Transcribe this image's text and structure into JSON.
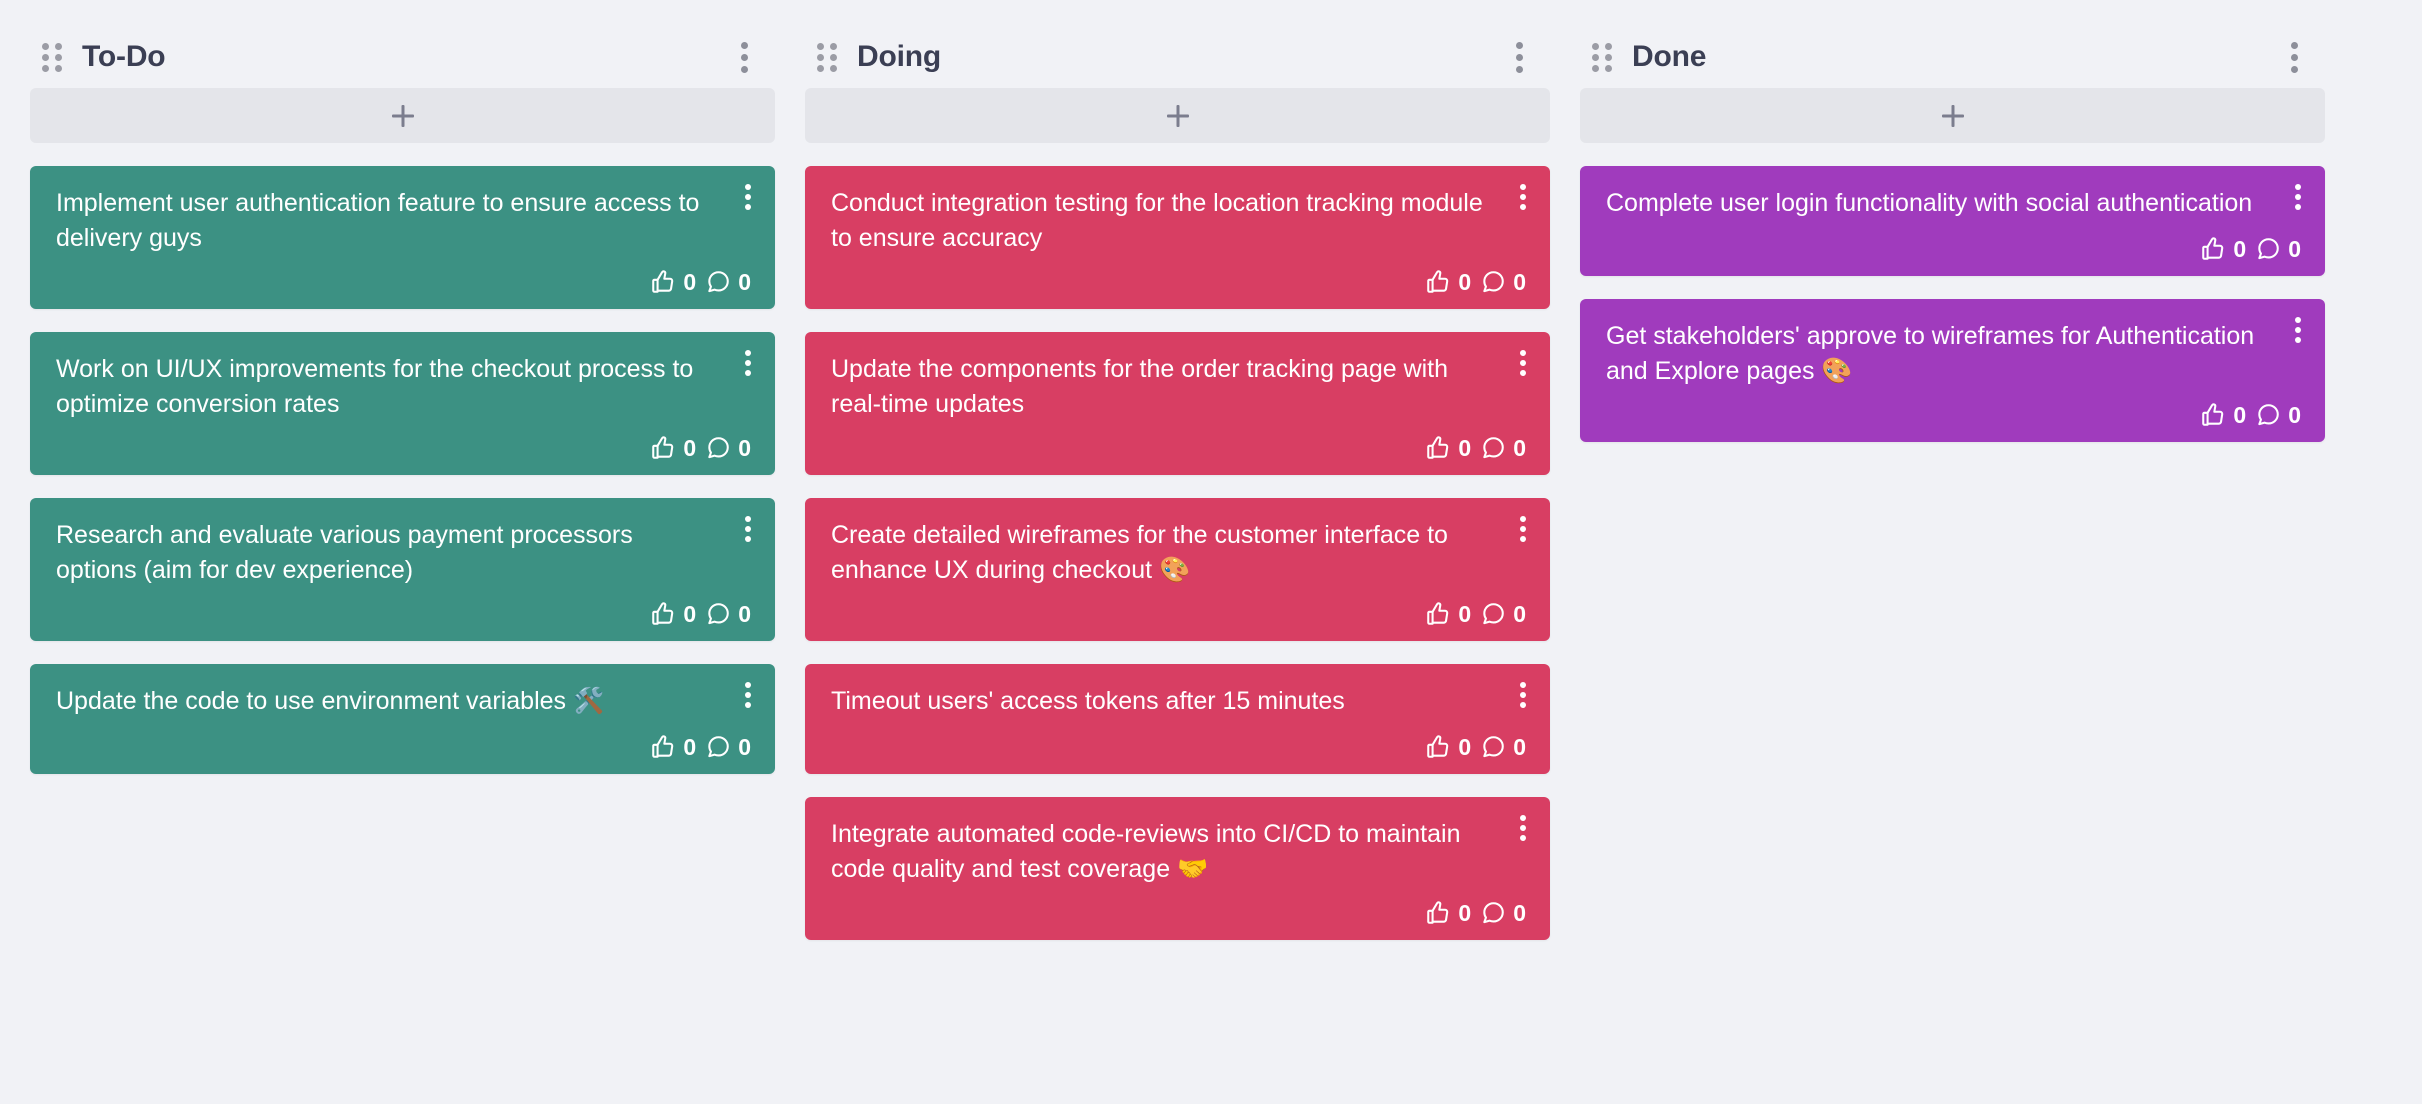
{
  "board": {
    "background_color": "#f1f2f6",
    "add_button_label": "+",
    "add_bar_color": "#e4e5ea"
  },
  "columns": [
    {
      "id": "todo",
      "title": "To-Do",
      "card_color": "#3c9183",
      "drag_handle_icon": "drag-dots-icon",
      "menu_icon": "more-vertical-icon",
      "add_icon": "plus-icon",
      "cards": [
        {
          "text": "Implement user authentication feature to ensure access to delivery guys",
          "likes": "0",
          "comments": "0",
          "like_icon": "thumbs-up-icon",
          "comment_icon": "comment-bubble-icon",
          "menu_icon": "more-vertical-icon"
        },
        {
          "text": "Work on UI/UX improvements for the checkout process to optimize conversion rates",
          "likes": "0",
          "comments": "0",
          "like_icon": "thumbs-up-icon",
          "comment_icon": "comment-bubble-icon",
          "menu_icon": "more-vertical-icon"
        },
        {
          "text": "Research and evaluate various payment processors options (aim for dev experience)",
          "likes": "0",
          "comments": "0",
          "like_icon": "thumbs-up-icon",
          "comment_icon": "comment-bubble-icon",
          "menu_icon": "more-vertical-icon"
        },
        {
          "text": "Update the code to use environment variables 🛠️",
          "likes": "0",
          "comments": "0",
          "like_icon": "thumbs-up-icon",
          "comment_icon": "comment-bubble-icon",
          "menu_icon": "more-vertical-icon"
        }
      ]
    },
    {
      "id": "doing",
      "title": "Doing",
      "card_color": "#d83e63",
      "drag_handle_icon": "drag-dots-icon",
      "menu_icon": "more-vertical-icon",
      "add_icon": "plus-icon",
      "cards": [
        {
          "text": "Conduct integration testing for the location tracking module to ensure accuracy",
          "likes": "0",
          "comments": "0",
          "like_icon": "thumbs-up-icon",
          "comment_icon": "comment-bubble-icon",
          "menu_icon": "more-vertical-icon"
        },
        {
          "text": "Update the components for the order tracking page with real-time updates",
          "likes": "0",
          "comments": "0",
          "like_icon": "thumbs-up-icon",
          "comment_icon": "comment-bubble-icon",
          "menu_icon": "more-vertical-icon"
        },
        {
          "text": "Create detailed wireframes for the customer interface to enhance UX during checkout 🎨",
          "likes": "0",
          "comments": "0",
          "like_icon": "thumbs-up-icon",
          "comment_icon": "comment-bubble-icon",
          "menu_icon": "more-vertical-icon"
        },
        {
          "text": "Timeout users' access tokens after 15 minutes",
          "likes": "0",
          "comments": "0",
          "like_icon": "thumbs-up-icon",
          "comment_icon": "comment-bubble-icon",
          "menu_icon": "more-vertical-icon"
        },
        {
          "text": "Integrate automated code-reviews into CI/CD to maintain code quality and test coverage 🤝",
          "likes": "0",
          "comments": "0",
          "like_icon": "thumbs-up-icon",
          "comment_icon": "comment-bubble-icon",
          "menu_icon": "more-vertical-icon"
        }
      ]
    },
    {
      "id": "done",
      "title": "Done",
      "card_color": "#a03bbd",
      "drag_handle_icon": "drag-dots-icon",
      "menu_icon": "more-vertical-icon",
      "add_icon": "plus-icon",
      "cards": [
        {
          "text": "Complete user login functionality with social authentication",
          "likes": "0",
          "comments": "0",
          "like_icon": "thumbs-up-icon",
          "comment_icon": "comment-bubble-icon",
          "menu_icon": "more-vertical-icon"
        },
        {
          "text": "Get stakeholders' approve to wireframes for Authentication and Explore pages 🎨",
          "likes": "0",
          "comments": "0",
          "like_icon": "thumbs-up-icon",
          "comment_icon": "comment-bubble-icon",
          "menu_icon": "more-vertical-icon"
        }
      ]
    }
  ]
}
